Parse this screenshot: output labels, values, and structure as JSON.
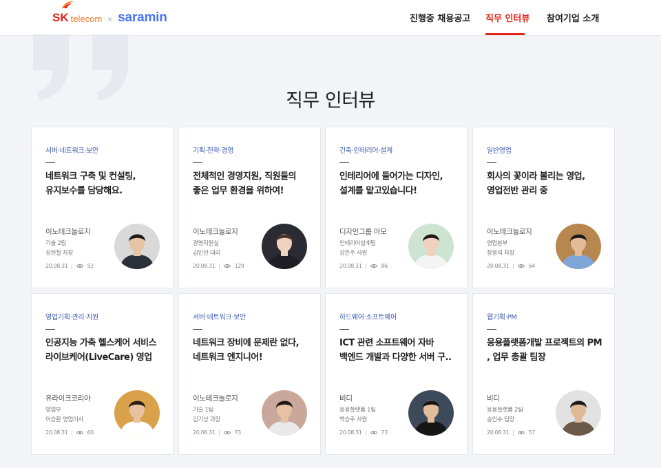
{
  "header": {
    "logo": {
      "sk": "SK",
      "telecom": "telecom",
      "separator": "×",
      "partner": "saramin"
    },
    "nav": [
      {
        "label": "진행중 채용공고"
      },
      {
        "label": "직무 인터뷰"
      },
      {
        "label": "참여기업 소개"
      }
    ]
  },
  "page": {
    "title": "직무 인터뷰"
  },
  "cards": [
    {
      "category": "서버·네트워크·보안",
      "title": "네트워크 구축 및 컨설팅, 유지보수를 담당해요.",
      "company": "이노테크놀로지",
      "dept": "기술 2팀",
      "person": "성현철 차장",
      "date": "20.08.31",
      "views": "52",
      "avatar": {
        "bg": "#d9d9d9",
        "shirt": "#2a2f3a",
        "hair": "#1a1a1a",
        "skin": "#e6c3a5"
      }
    },
    {
      "category": "기획·전략·경영",
      "title": "전체적인 경영지원, 직원들의 좋은 업무 환경을 위하여!",
      "company": "이노테크놀로지",
      "dept": "경영지원실",
      "person": "김인선 대리",
      "date": "20.08.31",
      "views": "129",
      "avatar": {
        "bg": "#2b2b33",
        "shirt": "#1e1e24",
        "hair": "#4a3528",
        "skin": "#f0d2c0"
      }
    },
    {
      "category": "건축·인테리어·설계",
      "title": "인테리어에 들어가는 디자인, 설계를 맡고있습니다!",
      "company": "디자인그룹 아모",
      "dept": "인테리어설계팀",
      "person": "강은주 사원",
      "date": "20.08.31",
      "views": "86",
      "avatar": {
        "bg": "#cfe3d2",
        "shirt": "#f4f4f4",
        "hair": "#1d1a18",
        "skin": "#efd1bd"
      }
    },
    {
      "category": "일반영업",
      "title": "회사의 꽃이라 불리는 영업, 영업전반 관리 중",
      "company": "이노테크놀로지",
      "dept": "영업본부",
      "person": "장응석 차장",
      "date": "20.08.31",
      "views": "64",
      "avatar": {
        "bg": "#b88750",
        "shirt": "#7fa6d6",
        "hair": "#1a1a1a",
        "skin": "#e3bb98"
      }
    },
    {
      "category": "영업기획·관리·지원",
      "title": "인공지능 가축 헬스케어 서비스 라이브케어(LiveCare) 영업",
      "company": "유라이크코리아",
      "dept": "영업부",
      "person": "이승환 영업이사",
      "date": "20.08.31",
      "views": "60",
      "avatar": {
        "bg": "#d9a24a",
        "shirt": "#ffffff",
        "hair": "#2a1d14",
        "skin": "#e8c2a0"
      }
    },
    {
      "category": "서버·네트워크·보안",
      "title": "네트워크 장비에 문제란 없다, 네트워크 엔지니어!",
      "company": "이노테크놀로지",
      "dept": "기술 1팀",
      "person": "김기상 과장",
      "date": "20.08.31",
      "views": "73",
      "avatar": {
        "bg": "#c9a89b",
        "shirt": "#e9e9e9",
        "hair": "#1d1814",
        "skin": "#e6c1a3"
      }
    },
    {
      "category": "하드웨어·소프트웨어",
      "title": "ICT 관련 소프트웨어 자바 백엔드 개발과 다양한 서버 구..",
      "company": "비디",
      "dept": "응용플랫폼 1팀",
      "person": "백승주 사원",
      "date": "20.08.31",
      "views": "73",
      "avatar": {
        "bg": "#3d4a5a",
        "shirt": "#161616",
        "hair": "#141414",
        "skin": "#e2bc9c"
      }
    },
    {
      "category": "웹기획·PM",
      "title": "응용플랫폼개발 프로젝트의 PM , 업무 총괄 팀장",
      "company": "비디",
      "dept": "응용플랫폼 2팀",
      "person": "송인수 팀장",
      "date": "20.08.31",
      "views": "57",
      "avatar": {
        "bg": "#e2e2e2",
        "shirt": "#6c5a48",
        "hair": "#1a1a1a",
        "skin": "#e0b996"
      }
    }
  ]
}
